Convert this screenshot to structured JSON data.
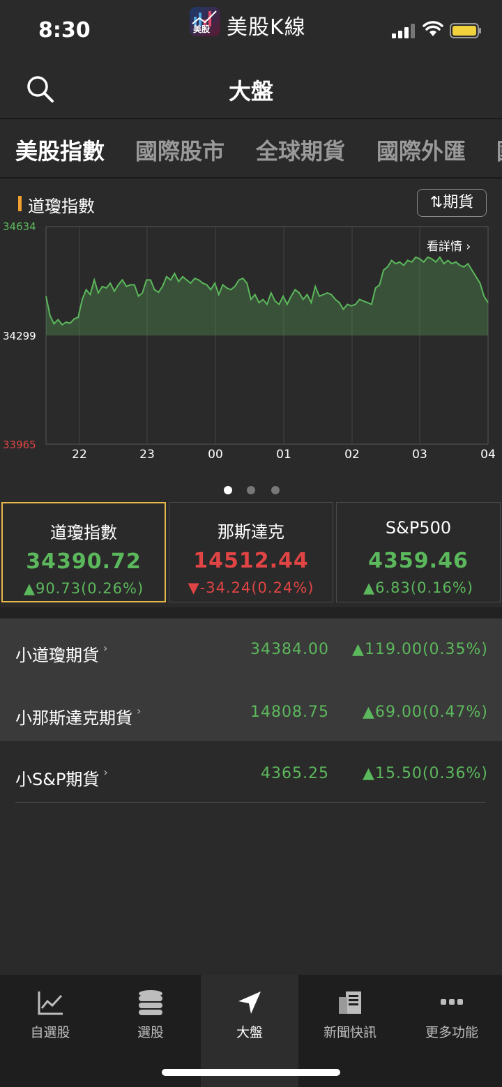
{
  "status_bar": {
    "time": "8:30",
    "app_badge_text": "美股",
    "app_name": "美股K線"
  },
  "header": {
    "title": "大盤"
  },
  "tabs": [
    {
      "label": "美股指數",
      "active": true
    },
    {
      "label": "國際股市",
      "active": false
    },
    {
      "label": "全球期貨",
      "active": false
    },
    {
      "label": "國際外匯",
      "active": false
    },
    {
      "label": "國",
      "active": false
    }
  ],
  "chart_section": {
    "title": "道瓊指數",
    "futures_button": "期貨",
    "details_link": "看詳情"
  },
  "chart_data": {
    "type": "area",
    "x_tick_labels": [
      "22",
      "23",
      "00",
      "01",
      "02",
      "03",
      "04"
    ],
    "y_axis_labels": {
      "top": "34634",
      "mid": "34299",
      "bottom": "33965"
    },
    "ylim": [
      33965,
      34634
    ],
    "baseline": 34299,
    "series": [
      {
        "color": "#5cb85c",
        "values": [
          34420,
          34360,
          34335,
          34348,
          34332,
          34340,
          34337,
          34350,
          34355,
          34410,
          34440,
          34425,
          34470,
          34430,
          34450,
          34445,
          34460,
          34435,
          34455,
          34470,
          34450,
          34455,
          34455,
          34420,
          34430,
          34470,
          34470,
          34440,
          34432,
          34450,
          34480,
          34470,
          34490,
          34465,
          34480,
          34470,
          34460,
          34475,
          34470,
          34460,
          34455,
          34440,
          34460,
          34425,
          34455,
          34445,
          34440,
          34450,
          34470,
          34475,
          34460,
          34410,
          34425,
          34400,
          34410,
          34395,
          34430,
          34405,
          34395,
          34420,
          34395,
          34420,
          34440,
          34430,
          34410,
          34425,
          34400,
          34450,
          34420,
          34425,
          34430,
          34425,
          34410,
          34400,
          34380,
          34395,
          34390,
          34395,
          34410,
          34405,
          34400,
          34395,
          34445,
          34455,
          34500,
          34510,
          34530,
          34520,
          34525,
          34515,
          34530,
          34525,
          34540,
          34535,
          34525,
          34540,
          34535,
          34525,
          34540,
          34520,
          34530,
          34520,
          34525,
          34515,
          34510,
          34520,
          34500,
          34480,
          34460,
          34420,
          34400
        ]
      }
    ],
    "grid": true
  },
  "page_indicator": {
    "count": 3,
    "active": 0
  },
  "index_cards": [
    {
      "name": "道瓊指數",
      "price": "34390.72",
      "change": "▲90.73(0.26%)",
      "direction": "up",
      "selected": true
    },
    {
      "name": "那斯達克",
      "price": "14512.44",
      "change": "▼-34.24(0.24%)",
      "direction": "down",
      "selected": false
    },
    {
      "name": "S&P500",
      "price": "4359.46",
      "change": "▲6.83(0.16%)",
      "direction": "up",
      "selected": false
    }
  ],
  "futures": [
    {
      "name": "小道瓊期貨",
      "price": "34384.00",
      "change": "▲119.00(0.35%)"
    },
    {
      "name": "小那斯達克期貨",
      "price": "14808.75",
      "change": "▲69.00(0.47%)"
    },
    {
      "name": "小S&P期貨",
      "price": "4365.25",
      "change": "▲15.50(0.36%)"
    }
  ],
  "bottom_nav": [
    {
      "label": "自選股",
      "icon": "line-chart-icon",
      "active": false
    },
    {
      "label": "選股",
      "icon": "database-icon",
      "active": false
    },
    {
      "label": "大盤",
      "icon": "navigation-arrow-icon",
      "active": true
    },
    {
      "label": "新聞快訊",
      "icon": "newspaper-icon",
      "active": false
    },
    {
      "label": "更多功能",
      "icon": "more-dots-icon",
      "active": false
    }
  ],
  "colors": {
    "up": "#5cb85c",
    "down": "#e04444",
    "accent": "#f0a030",
    "card_selected": "#e8b84a"
  }
}
